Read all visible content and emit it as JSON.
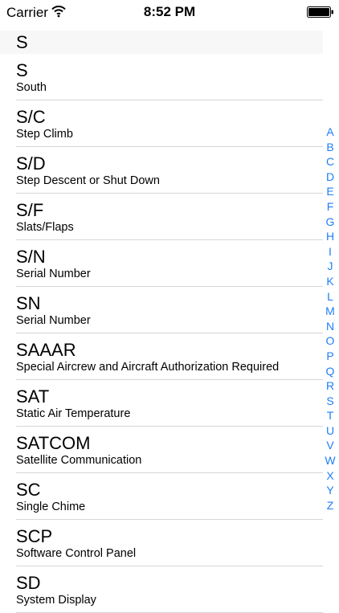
{
  "status_bar": {
    "carrier": "Carrier",
    "time": "8:52 PM"
  },
  "section": {
    "title": "S"
  },
  "entries": [
    {
      "abbr": "S",
      "meaning": "South"
    },
    {
      "abbr": "S/C",
      "meaning": "Step Climb"
    },
    {
      "abbr": "S/D",
      "meaning": "Step Descent or Shut Down"
    },
    {
      "abbr": "S/F",
      "meaning": "Slats/Flaps"
    },
    {
      "abbr": "S/N",
      "meaning": "Serial Number"
    },
    {
      "abbr": "SN",
      "meaning": "Serial Number"
    },
    {
      "abbr": "SAAAR",
      "meaning": "Special Aircrew and Aircraft Authorization Required"
    },
    {
      "abbr": "SAT",
      "meaning": "Static Air Temperature"
    },
    {
      "abbr": "SATCOM",
      "meaning": "Satellite Communication"
    },
    {
      "abbr": "SC",
      "meaning": "Single Chime"
    },
    {
      "abbr": "SCP",
      "meaning": "Software Control Panel"
    },
    {
      "abbr": "SD",
      "meaning": "System Display"
    }
  ],
  "index_letters": [
    "A",
    "B",
    "C",
    "D",
    "E",
    "F",
    "G",
    "H",
    "I",
    "J",
    "K",
    "L",
    "M",
    "N",
    "O",
    "P",
    "Q",
    "R",
    "S",
    "T",
    "U",
    "V",
    "W",
    "X",
    "Y",
    "Z"
  ],
  "colors": {
    "accent": "#1e7ef7",
    "separator": "#d6d6d6",
    "section_bg": "#f7f7f7"
  }
}
